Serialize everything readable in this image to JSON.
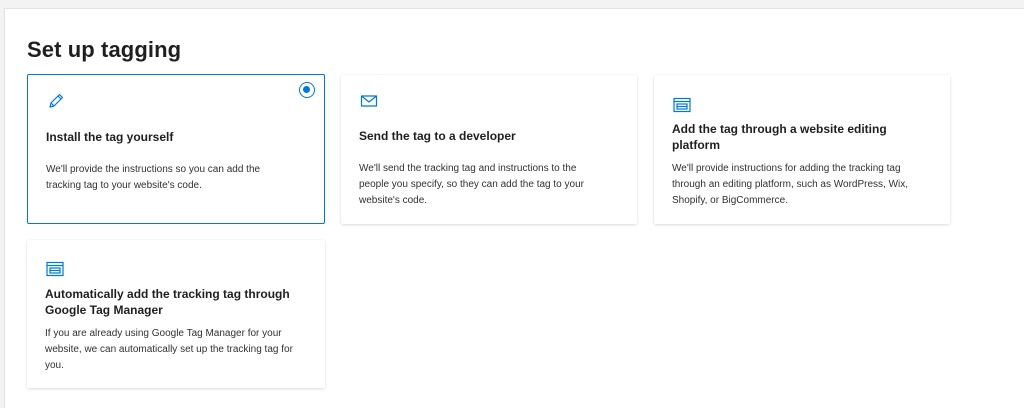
{
  "page": {
    "title": "Set up tagging"
  },
  "accent_color": "#0078d4",
  "options": [
    {
      "icon": "pencil-icon",
      "title": "Install the tag yourself",
      "description": "We'll provide the instructions so you can add the tracking tag to your website's code.",
      "selected": true
    },
    {
      "icon": "envelope-icon",
      "title": "Send the tag to a developer",
      "description": "We'll send the tracking tag and instructions to the people you specify, so they can add the tag to your website's code.",
      "selected": false
    },
    {
      "icon": "browser-window-icon",
      "title": "Add the tag through a website editing platform",
      "description": "We'll provide instructions for adding the tracking tag through an editing platform, such as WordPress, Wix, Shopify, or BigCommerce.",
      "selected": false
    },
    {
      "icon": "browser-window-icon",
      "title": "Automatically add the tracking tag through Google Tag Manager",
      "description": "If you are already using Google Tag Manager for your website, we can automatically set up the tracking tag for you.",
      "selected": false
    }
  ]
}
